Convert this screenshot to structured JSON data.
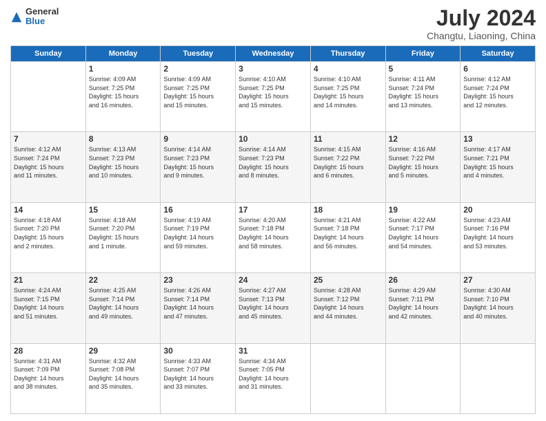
{
  "logo": {
    "general": "General",
    "blue": "Blue"
  },
  "header": {
    "month": "July 2024",
    "location": "Changtu, Liaoning, China"
  },
  "days_of_week": [
    "Sunday",
    "Monday",
    "Tuesday",
    "Wednesday",
    "Thursday",
    "Friday",
    "Saturday"
  ],
  "weeks": [
    [
      {
        "day": "",
        "info": ""
      },
      {
        "day": "1",
        "info": "Sunrise: 4:09 AM\nSunset: 7:25 PM\nDaylight: 15 hours\nand 16 minutes."
      },
      {
        "day": "2",
        "info": "Sunrise: 4:09 AM\nSunset: 7:25 PM\nDaylight: 15 hours\nand 15 minutes."
      },
      {
        "day": "3",
        "info": "Sunrise: 4:10 AM\nSunset: 7:25 PM\nDaylight: 15 hours\nand 15 minutes."
      },
      {
        "day": "4",
        "info": "Sunrise: 4:10 AM\nSunset: 7:25 PM\nDaylight: 15 hours\nand 14 minutes."
      },
      {
        "day": "5",
        "info": "Sunrise: 4:11 AM\nSunset: 7:24 PM\nDaylight: 15 hours\nand 13 minutes."
      },
      {
        "day": "6",
        "info": "Sunrise: 4:12 AM\nSunset: 7:24 PM\nDaylight: 15 hours\nand 12 minutes."
      }
    ],
    [
      {
        "day": "7",
        "info": "Sunrise: 4:12 AM\nSunset: 7:24 PM\nDaylight: 15 hours\nand 11 minutes."
      },
      {
        "day": "8",
        "info": "Sunrise: 4:13 AM\nSunset: 7:23 PM\nDaylight: 15 hours\nand 10 minutes."
      },
      {
        "day": "9",
        "info": "Sunrise: 4:14 AM\nSunset: 7:23 PM\nDaylight: 15 hours\nand 9 minutes."
      },
      {
        "day": "10",
        "info": "Sunrise: 4:14 AM\nSunset: 7:23 PM\nDaylight: 15 hours\nand 8 minutes."
      },
      {
        "day": "11",
        "info": "Sunrise: 4:15 AM\nSunset: 7:22 PM\nDaylight: 15 hours\nand 6 minutes."
      },
      {
        "day": "12",
        "info": "Sunrise: 4:16 AM\nSunset: 7:22 PM\nDaylight: 15 hours\nand 5 minutes."
      },
      {
        "day": "13",
        "info": "Sunrise: 4:17 AM\nSunset: 7:21 PM\nDaylight: 15 hours\nand 4 minutes."
      }
    ],
    [
      {
        "day": "14",
        "info": "Sunrise: 4:18 AM\nSunset: 7:20 PM\nDaylight: 15 hours\nand 2 minutes."
      },
      {
        "day": "15",
        "info": "Sunrise: 4:18 AM\nSunset: 7:20 PM\nDaylight: 15 hours\nand 1 minute."
      },
      {
        "day": "16",
        "info": "Sunrise: 4:19 AM\nSunset: 7:19 PM\nDaylight: 14 hours\nand 59 minutes."
      },
      {
        "day": "17",
        "info": "Sunrise: 4:20 AM\nSunset: 7:18 PM\nDaylight: 14 hours\nand 58 minutes."
      },
      {
        "day": "18",
        "info": "Sunrise: 4:21 AM\nSunset: 7:18 PM\nDaylight: 14 hours\nand 56 minutes."
      },
      {
        "day": "19",
        "info": "Sunrise: 4:22 AM\nSunset: 7:17 PM\nDaylight: 14 hours\nand 54 minutes."
      },
      {
        "day": "20",
        "info": "Sunrise: 4:23 AM\nSunset: 7:16 PM\nDaylight: 14 hours\nand 53 minutes."
      }
    ],
    [
      {
        "day": "21",
        "info": "Sunrise: 4:24 AM\nSunset: 7:15 PM\nDaylight: 14 hours\nand 51 minutes."
      },
      {
        "day": "22",
        "info": "Sunrise: 4:25 AM\nSunset: 7:14 PM\nDaylight: 14 hours\nand 49 minutes."
      },
      {
        "day": "23",
        "info": "Sunrise: 4:26 AM\nSunset: 7:14 PM\nDaylight: 14 hours\nand 47 minutes."
      },
      {
        "day": "24",
        "info": "Sunrise: 4:27 AM\nSunset: 7:13 PM\nDaylight: 14 hours\nand 45 minutes."
      },
      {
        "day": "25",
        "info": "Sunrise: 4:28 AM\nSunset: 7:12 PM\nDaylight: 14 hours\nand 44 minutes."
      },
      {
        "day": "26",
        "info": "Sunrise: 4:29 AM\nSunset: 7:11 PM\nDaylight: 14 hours\nand 42 minutes."
      },
      {
        "day": "27",
        "info": "Sunrise: 4:30 AM\nSunset: 7:10 PM\nDaylight: 14 hours\nand 40 minutes."
      }
    ],
    [
      {
        "day": "28",
        "info": "Sunrise: 4:31 AM\nSunset: 7:09 PM\nDaylight: 14 hours\nand 38 minutes."
      },
      {
        "day": "29",
        "info": "Sunrise: 4:32 AM\nSunset: 7:08 PM\nDaylight: 14 hours\nand 35 minutes."
      },
      {
        "day": "30",
        "info": "Sunrise: 4:33 AM\nSunset: 7:07 PM\nDaylight: 14 hours\nand 33 minutes."
      },
      {
        "day": "31",
        "info": "Sunrise: 4:34 AM\nSunset: 7:05 PM\nDaylight: 14 hours\nand 31 minutes."
      },
      {
        "day": "",
        "info": ""
      },
      {
        "day": "",
        "info": ""
      },
      {
        "day": "",
        "info": ""
      }
    ]
  ]
}
